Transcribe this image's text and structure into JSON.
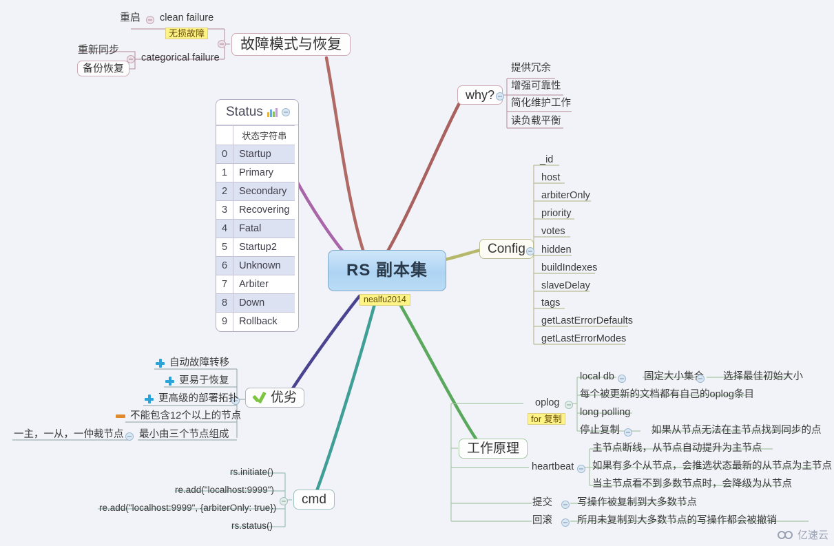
{
  "root": {
    "title": "RS 副本集",
    "tag": "nealfu2014"
  },
  "watermark": {
    "text": "亿速云",
    "icon": "cloud-icon"
  },
  "branches": {
    "failure": {
      "label": "故障模式与恢复",
      "children": [
        {
          "label": "clean  failure",
          "sub": [
            "重启"
          ],
          "note": "无损故障"
        },
        {
          "label": "categorical failure",
          "sub": [
            "重新同步",
            "备份恢复"
          ]
        }
      ]
    },
    "why": {
      "label": "why?",
      "children": [
        "提供冗余",
        "增强可靠性",
        "简化维护工作",
        "读负载平衡"
      ]
    },
    "config": {
      "label": "Config",
      "children": [
        "_id",
        "host",
        "arbiterOnly",
        "priority",
        "votes",
        "hidden",
        "buildIndexes",
        "slaveDelay",
        "tags",
        "getLastErrorDefaults",
        "getLastErrorModes"
      ]
    },
    "status": {
      "label": "Status",
      "icon": "chart-icon",
      "column_header": "状态字符串",
      "rows": [
        {
          "index": "0",
          "value": "Startup"
        },
        {
          "index": "1",
          "value": "Primary"
        },
        {
          "index": "2",
          "value": "Secondary"
        },
        {
          "index": "3",
          "value": "Recovering"
        },
        {
          "index": "4",
          "value": "Fatal"
        },
        {
          "index": "5",
          "value": "Startup2"
        },
        {
          "index": "6",
          "value": "Unknown"
        },
        {
          "index": "7",
          "value": "Arbiter"
        },
        {
          "index": "8",
          "value": "Down"
        },
        {
          "index": "9",
          "value": "Rollback"
        }
      ]
    },
    "proscons": {
      "label": "优劣",
      "icon": "check-icon",
      "children": [
        {
          "label": "自动故障转移",
          "marker": "plus"
        },
        {
          "label": "更易于恢复",
          "marker": "plus"
        },
        {
          "label": "更高级的部署拓扑",
          "marker": "plus"
        },
        {
          "label": "不能包含12个以上的节点",
          "marker": "minus"
        },
        {
          "label": "最小由三个节点组成",
          "marker": "none",
          "sub": "一主，一从，一仲裁节点"
        }
      ]
    },
    "cmd": {
      "label": "cmd",
      "children": [
        "rs.initiate()",
        "re.add(\"localhost:9999\")",
        "re.add(\"localhost:9999\", {arbiterOnly: true})",
        "rs.status()"
      ]
    },
    "principle": {
      "label": "工作原理",
      "oplog": {
        "label": "oplog",
        "note": "for 复制",
        "children": [
          {
            "label": "local db",
            "sub": "固定大小集合",
            "sub2": "选择最佳初始大小"
          },
          {
            "label": "每个被更新的文档都有自己的oplog条目"
          },
          {
            "label": "long polling"
          },
          {
            "label": "停止复制",
            "sub": "如果从节点无法在主节点找到同步的点"
          }
        ]
      },
      "heartbeat": {
        "label": "heartbeat",
        "children": [
          "主节点断线，从节点自动提升为主节点",
          "如果有多个从节点，会推选状态最新的从节点为主节点",
          "当主节点看不到多数节点时，会降级为从节点"
        ]
      },
      "commit": {
        "label": "提交",
        "value": "写操作被复制到大多数节点"
      },
      "rollback": {
        "label": "回滚",
        "value": "所用未复制到大多数节点的写操作都会被撤销"
      }
    }
  },
  "colors": {
    "background": "#f2f3f8",
    "root_fill": "#aed4f3",
    "edge_failure": "#b06a66",
    "edge_why": "#a8615f",
    "edge_config": "#b5b86a",
    "edge_status": "#a866a8",
    "edge_proscons": "#4a4490",
    "edge_cmd": "#3f9e95",
    "edge_principle": "#5aa85e",
    "highlight": "#fdf485"
  }
}
